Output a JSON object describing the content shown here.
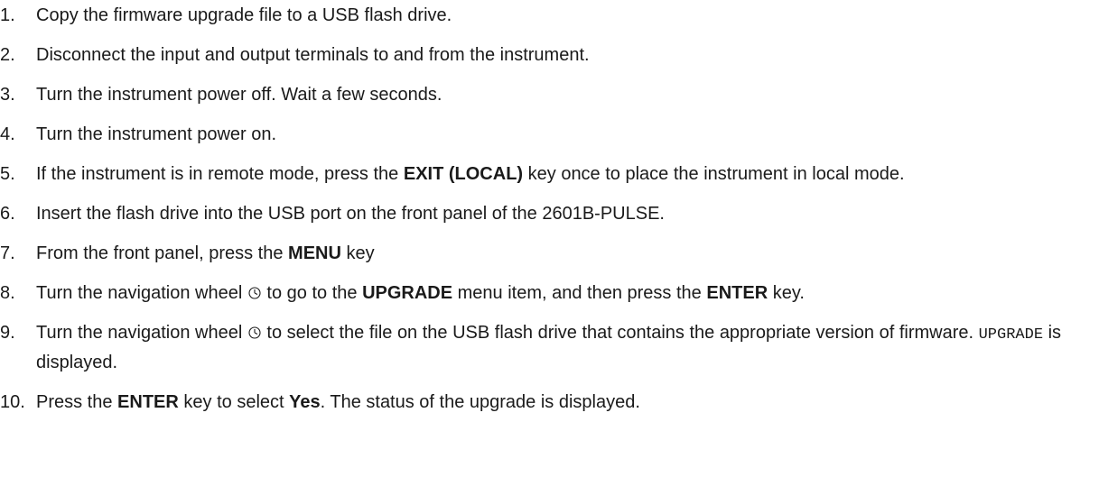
{
  "steps": [
    {
      "number": "1.",
      "parts": [
        "Copy the firmware upgrade file to a USB flash drive."
      ]
    },
    {
      "number": "2.",
      "parts": [
        "Disconnect the input and output terminals to and from the instrument."
      ]
    },
    {
      "number": "3.",
      "parts": [
        "Turn the instrument power off. Wait a few seconds."
      ]
    },
    {
      "number": "4.",
      "parts": [
        "Turn the instrument power on."
      ]
    },
    {
      "number": "5.",
      "parts": [
        "If the instrument is in remote mode, press the ",
        "EXIT (LOCAL)",
        " key once to place the instrument in local mode."
      ]
    },
    {
      "number": "6.",
      "parts": [
        "Insert the flash drive into the USB port on the front panel of the 2601B-PULSE."
      ]
    },
    {
      "number": "7.",
      "parts": [
        "From the front panel, press the ",
        "MENU",
        " key"
      ]
    },
    {
      "number": "8.",
      "parts": [
        "Turn the navigation wheel ",
        " to go to the ",
        "UPGRADE",
        " menu item, and then press the ",
        "ENTER",
        " key."
      ]
    },
    {
      "number": "9.",
      "parts": [
        "Turn the navigation wheel ",
        " to select the file on the USB flash drive that contains the appropriate version of firmware. ",
        "UPGRADE",
        " is displayed."
      ]
    },
    {
      "number": "10.",
      "parts": [
        "Press the ",
        "ENTER",
        " key to select ",
        "Yes",
        ". The status of the upgrade is displayed."
      ]
    }
  ],
  "icons": {
    "navigation_wheel": "navigation-wheel-icon"
  }
}
